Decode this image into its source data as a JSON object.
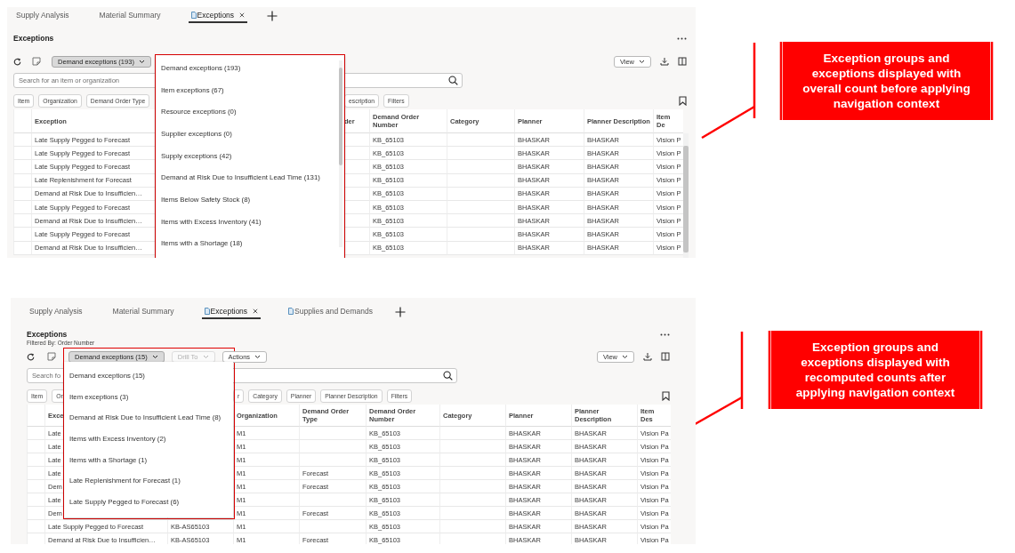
{
  "screens": [
    {
      "tabs": [
        {
          "label": "Supply Analysis",
          "kind": "plain",
          "selected": false,
          "closable": false
        },
        {
          "label": "Material Summary",
          "kind": "plain",
          "selected": false,
          "closable": false
        },
        {
          "label": "Exceptions",
          "kind": "document",
          "selected": true,
          "closable": true
        }
      ],
      "title": "Exceptions",
      "toolbar": {
        "group_selector": "Demand exceptions (193)",
        "view_button": "View"
      },
      "search": {
        "placeholder": "Search for an item or organization"
      },
      "filter_chips": [
        "Item",
        "Organization",
        "Demand Order Type",
        "escription",
        "Filters"
      ],
      "table": {
        "columns": [
          "Exception",
          null,
          "der",
          "Demand Order Number",
          "Category",
          "Planner",
          "Planner Description",
          "Item De"
        ],
        "rows": [
          [
            "Late Supply Pegged to Forecast",
            null,
            null,
            "KB_65103",
            null,
            "BHASKAR",
            "BHASKAR",
            "Vision P"
          ],
          [
            "Late Supply Pegged to Forecast",
            null,
            null,
            "KB_65103",
            null,
            "BHASKAR",
            "BHASKAR",
            "Vision P"
          ],
          [
            "Late Supply Pegged to Forecast",
            null,
            null,
            "KB_65103",
            null,
            "BHASKAR",
            "BHASKAR",
            "Vision P"
          ],
          [
            "Late Replenishment for Forecast",
            null,
            null,
            "KB_65103",
            null,
            "BHASKAR",
            "BHASKAR",
            "Vision P"
          ],
          [
            "Demand at Risk Due to Insufficien…",
            null,
            null,
            "KB_65103",
            null,
            "BHASKAR",
            "BHASKAR",
            "Vision P"
          ],
          [
            "Late Supply Pegged to Forecast",
            null,
            null,
            "KB_65103",
            null,
            "BHASKAR",
            "BHASKAR",
            "Vision P"
          ],
          [
            "Demand at Risk Due to Insufficien…",
            null,
            null,
            "KB_65103",
            null,
            "BHASKAR",
            "BHASKAR",
            "Vision P"
          ],
          [
            "Late Supply Pegged to Forecast",
            null,
            null,
            "KB_65103",
            null,
            "BHASKAR",
            "BHASKAR",
            "Vision P"
          ],
          [
            "Demand at Risk Due to Insufficien…",
            null,
            null,
            "KB_65103",
            null,
            "BHASKAR",
            "BHASKAR",
            "Vision P"
          ]
        ]
      },
      "menu": {
        "items": [
          "Demand exceptions (193)",
          "Item exceptions (67)",
          "Resource exceptions (0)",
          "Supplier exceptions (0)",
          "Supply exceptions (42)",
          "Demand at Risk Due to Insufficient Lead Time (131)",
          "Items Below Safety Stock (8)",
          "Items with Excess Inventory (41)",
          "Items with a Shortage (18)"
        ]
      }
    },
    {
      "tabs": [
        {
          "label": "Supply Analysis",
          "kind": "plain",
          "selected": false,
          "closable": false
        },
        {
          "label": "Material Summary",
          "kind": "plain",
          "selected": false,
          "closable": false
        },
        {
          "label": "Exceptions",
          "kind": "document",
          "selected": true,
          "closable": true
        },
        {
          "label": "Supplies and Demands",
          "kind": "document",
          "selected": false,
          "closable": false
        }
      ],
      "title": "Exceptions",
      "subtitle": "Filtered By: Order Number",
      "toolbar": {
        "group_selector": "Demand exceptions (15)",
        "buttons": [
          {
            "label": "Drill To",
            "disabled": true
          },
          {
            "label": "Actions",
            "disabled": false
          }
        ],
        "view_button": "View"
      },
      "search": {
        "placeholder": "Search fo"
      },
      "filter_chips": [
        "Item",
        "Or",
        "r",
        "Category",
        "Planner",
        "Planner Description",
        "Filters"
      ],
      "table": {
        "columns": [
          "Exce",
          null,
          "Organization",
          "Demand Order Type",
          "Demand Order Number",
          "Category",
          "Planner",
          "Planner Description",
          "Item Des"
        ],
        "rows": [
          [
            "Late",
            null,
            "M1",
            null,
            "KB_65103",
            null,
            "BHASKAR",
            "BHASKAR",
            "Vision Pa"
          ],
          [
            "Late",
            null,
            "M1",
            null,
            "KB_65103",
            null,
            "BHASKAR",
            "BHASKAR",
            "Vision Pa"
          ],
          [
            "Late",
            null,
            "M1",
            null,
            "KB_65103",
            null,
            "BHASKAR",
            "BHASKAR",
            "Vision Pa"
          ],
          [
            "Late",
            null,
            "M1",
            "Forecast",
            "KB_65103",
            null,
            "BHASKAR",
            "BHASKAR",
            "Vision Pa"
          ],
          [
            "Dem",
            null,
            "M1",
            "Forecast",
            "KB_65103",
            null,
            "BHASKAR",
            "BHASKAR",
            "Vision Pa"
          ],
          [
            "Late",
            null,
            "M1",
            null,
            "KB_65103",
            null,
            "BHASKAR",
            "BHASKAR",
            "Vision Pa"
          ],
          [
            "Dem",
            null,
            "M1",
            "Forecast",
            "KB_65103",
            null,
            "BHASKAR",
            "BHASKAR",
            "Vision Pa"
          ],
          [
            "Late Supply Pegged to Forecast",
            "KB-AS65103",
            "M1",
            null,
            "KB_65103",
            null,
            "BHASKAR",
            "BHASKAR",
            "Vision Pa"
          ],
          [
            "Demand at Risk Due to Insufficien…",
            "KB-AS65103",
            "M1",
            "Forecast",
            "KB_65103",
            null,
            "BHASKAR",
            "BHASKAR",
            "Vision Pa"
          ]
        ]
      },
      "menu": {
        "items": [
          "Demand exceptions (15)",
          "Item exceptions (3)",
          "Demand at Risk Due to Insufficient Lead Time (8)",
          "Items with Excess Inventory (2)",
          "Items with a Shortage (1)",
          "Late Replenishment for Forecast (1)",
          "Late Supply Pegged to Forecast (6)"
        ]
      }
    }
  ],
  "callouts": [
    {
      "text": "Exception groups and\nexceptions displayed with\noverall count before applying\nnavigation context"
    },
    {
      "text": "Exception groups and\nexceptions displayed with\nrecomputed counts after\napplying navigation context"
    }
  ]
}
